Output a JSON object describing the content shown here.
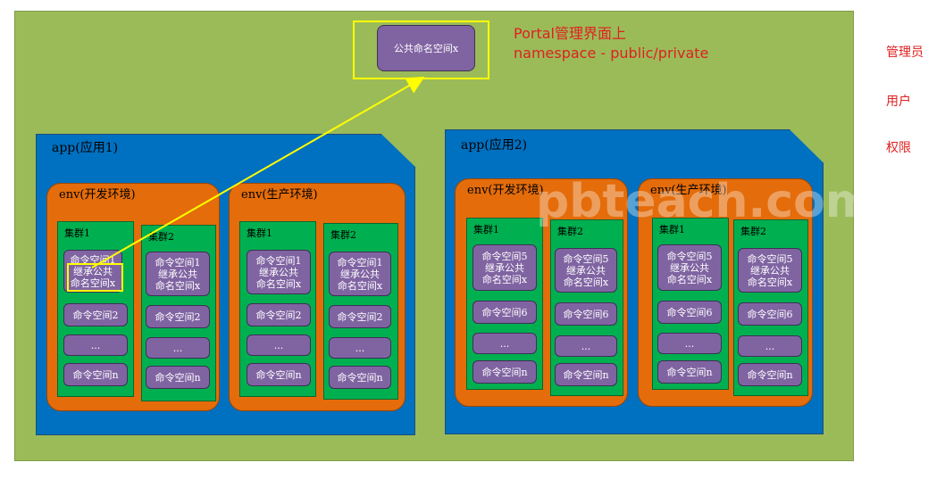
{
  "legend": {
    "items": [
      "管理员",
      "用户",
      "权限"
    ]
  },
  "portal": {
    "namespace_label": "公共命名空间x",
    "note_line1": "Portal管理界面上",
    "note_line2": "namespace - public/private"
  },
  "watermark": {
    "text": "pbteach.com"
  },
  "apps": [
    {
      "label": "app(应用1)",
      "envs": [
        {
          "label": "env(开发环境)",
          "clusters": [
            {
              "label": "集群1",
              "namespaces": [
                [
                  "命令空间1",
                  "继承公共",
                  "命名空间x"
                ],
                [
                  "命令空间2"
                ],
                [
                  "..."
                ],
                [
                  "命令空间n"
                ]
              ]
            },
            {
              "label": "集群2",
              "namespaces": [
                [
                  "命令空间1",
                  "继承公共",
                  "命名空间x"
                ],
                [
                  "命令空间2"
                ],
                [
                  "..."
                ],
                [
                  "命令空间n"
                ]
              ]
            }
          ]
        },
        {
          "label": "env(生产环境)",
          "clusters": [
            {
              "label": "集群1",
              "namespaces": [
                [
                  "命令空间1",
                  "继承公共",
                  "命名空间x"
                ],
                [
                  "命令空间2"
                ],
                [
                  "..."
                ],
                [
                  "命令空间n"
                ]
              ]
            },
            {
              "label": "集群2",
              "namespaces": [
                [
                  "命令空间1",
                  "继承公共",
                  "命名空间x"
                ],
                [
                  "命令空间2"
                ],
                [
                  "..."
                ],
                [
                  "命令空间n"
                ]
              ]
            }
          ]
        }
      ]
    },
    {
      "label": "app(应用2)",
      "envs": [
        {
          "label": "env(开发环境)",
          "clusters": [
            {
              "label": "集群1",
              "namespaces": [
                [
                  "命令空间5",
                  "继承公共",
                  "命名空间x"
                ],
                [
                  "命令空间6"
                ],
                [
                  "..."
                ],
                [
                  "命令空间n"
                ]
              ]
            },
            {
              "label": "集群2",
              "namespaces": [
                [
                  "命令空间5",
                  "继承公共",
                  "命名空间x"
                ],
                [
                  "命令空间6"
                ],
                [
                  "..."
                ],
                [
                  "命令空间n"
                ]
              ]
            }
          ]
        },
        {
          "label": "env(生产环境)",
          "clusters": [
            {
              "label": "集群1",
              "namespaces": [
                [
                  "命令空间5",
                  "继承公共",
                  "命名空间x"
                ],
                [
                  "命令空间6"
                ],
                [
                  "..."
                ],
                [
                  "命令空间n"
                ]
              ]
            },
            {
              "label": "集群2",
              "namespaces": [
                [
                  "命令空间5",
                  "继承公共",
                  "命名空间x"
                ],
                [
                  "命令空间6"
                ],
                [
                  "..."
                ],
                [
                  "命令空间n"
                ]
              ]
            }
          ]
        }
      ]
    }
  ],
  "colors": {
    "canvas": "#9bbb59",
    "app": "#0070c0",
    "env": "#e46c0a",
    "cluster": "#00b050",
    "namespace": "#8064a2",
    "highlight": "#ffff00",
    "note": "#e02020"
  }
}
